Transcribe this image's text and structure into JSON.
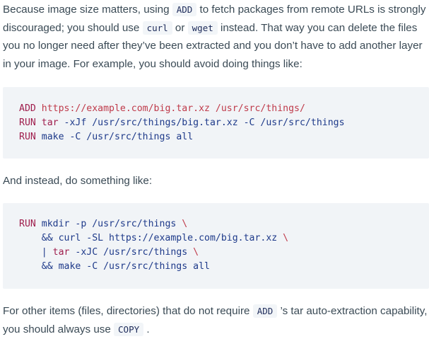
{
  "p1": {
    "t1": "Because image size matters, using ",
    "c1": "ADD",
    "t2": " to fetch packages from remote URLs is strongly discouraged; you should use ",
    "c2": "curl",
    "t3": " or ",
    "c3": "wget",
    "t4": " instead. That way you can delete the files you no longer need after they’ve been extracted and you don’t have to add another layer in your image. For example, you should avoid doing things like:"
  },
  "code1": {
    "l1_kw": "ADD",
    "l1_rest": " https://example.com/big.tar.xz /usr/src/things/",
    "l2_kw": "RUN",
    "l2_cmd": " tar",
    "l2_rest": " -xJf /usr/src/things/big.tar.xz -C /usr/src/things",
    "l3_kw": "RUN",
    "l3_rest": " make -C /usr/src/things all"
  },
  "p2": {
    "text": "And instead, do something like:"
  },
  "code2": {
    "l1_kw": "RUN",
    "l1_rest": " mkdir -p /usr/src/things ",
    "l1_bs": "\\",
    "l2_rest": "    && curl -SL https://example.com/big.tar.xz ",
    "l2_bs": "\\",
    "l3_pipe": "    | ",
    "l3_cmd": "tar",
    "l3_rest": " -xJC /usr/src/things ",
    "l3_bs": "\\",
    "l4_rest": "    && make -C /usr/src/things all"
  },
  "p3": {
    "t1": "For other items (files, directories) that do not require ",
    "c1": "ADD",
    "t2": " ’s tar auto-extraction capability, you should always use ",
    "c2": "COPY",
    "t3": " ."
  }
}
